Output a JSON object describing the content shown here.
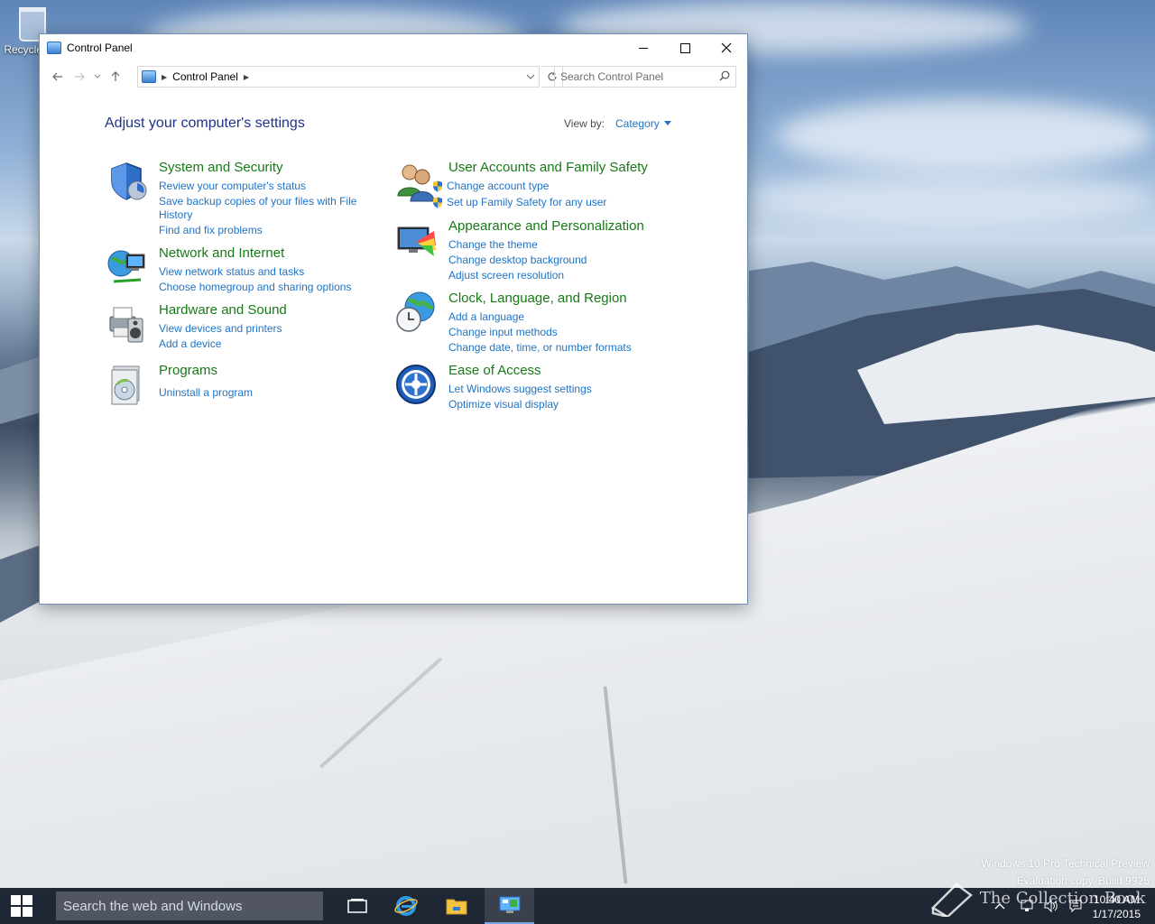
{
  "desktop": {
    "recycle_bin_label": "Recycle Bin",
    "watermark_line1": "Windows 10 Pro Technical Preview",
    "watermark_line2": "Evaluation copy. Build 9925",
    "brand_overlay": "The Collection Book"
  },
  "window": {
    "title": "Control Panel",
    "breadcrumb": "Control Panel",
    "search_placeholder": "Search Control Panel"
  },
  "content": {
    "heading": "Adjust your computer's settings",
    "view_by_label": "View by:",
    "view_by_value": "Category",
    "categories": [
      {
        "title": "System and Security",
        "icon": "shield-icon",
        "links": [
          "Review your computer's status",
          "Save backup copies of your files with File",
          "History",
          "Find and fix problems"
        ]
      },
      {
        "title": "Network and Internet",
        "icon": "globe-network-icon",
        "links": [
          "View network status and tasks",
          "Choose homegroup and sharing options"
        ]
      },
      {
        "title": "Hardware and Sound",
        "icon": "printer-speaker-icon",
        "links": [
          "View devices and printers",
          "Add a device"
        ]
      },
      {
        "title": "Programs",
        "icon": "programs-disc-icon",
        "links": [
          "Uninstall a program"
        ]
      },
      {
        "title": "User Accounts and Family Safety",
        "icon": "users-icon",
        "links": [
          "Change account type",
          "Set up Family Safety for any user"
        ]
      },
      {
        "title": "Appearance and Personalization",
        "icon": "monitor-palette-icon",
        "links": [
          "Change the theme",
          "Change desktop background",
          "Adjust screen resolution"
        ]
      },
      {
        "title": "Clock, Language, and Region",
        "icon": "clock-globe-icon",
        "links": [
          "Add a language",
          "Change input methods",
          "Change date, time, or number formats"
        ]
      },
      {
        "title": "Ease of Access",
        "icon": "ease-of-access-icon",
        "links": [
          "Let Windows suggest settings",
          "Optimize visual display"
        ]
      }
    ]
  },
  "taskbar": {
    "search_placeholder": "Search the web and Windows",
    "time": "10:40 AM",
    "date": "1/17/2015"
  },
  "colors": {
    "category_title": "#167a16",
    "link": "#1e73c6",
    "heading": "#1e3287"
  }
}
